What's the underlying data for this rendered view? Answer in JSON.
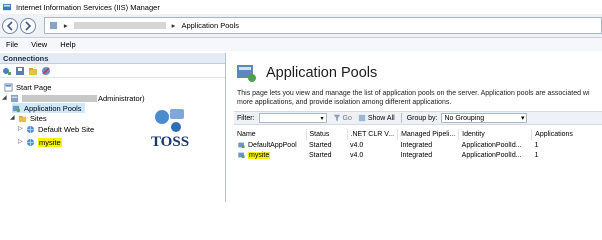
{
  "window": {
    "title": "Internet Information Services (IIS) Manager"
  },
  "address": {
    "segments": [
      "",
      "Application Pools"
    ]
  },
  "menu": {
    "items": [
      "File",
      "View",
      "Help"
    ]
  },
  "connections": {
    "header": "Connections",
    "tree": {
      "start_page": "Start Page",
      "server": "Administrator)",
      "app_pools": "Application Pools",
      "sites": "Sites",
      "default_site": "Default Web Site",
      "mysite": "mysite"
    }
  },
  "main": {
    "title": "Application Pools",
    "description_line1": "This page lets you view and manage the list of application pools on the server. Application pools are associated wi",
    "description_line2": "more applications, and provide isolation among different applications.",
    "filter": {
      "label": "Filter:",
      "go": "Go",
      "show_all": "Show All",
      "group_by_label": "Group by:",
      "group_by_value": "No Grouping"
    },
    "table": {
      "headers": [
        "Name",
        "Status",
        ".NET CLR V...",
        "Managed Pipeli...",
        "Identity",
        "Applications"
      ],
      "rows": [
        [
          "DefaultAppPool",
          "Started",
          "v4.0",
          "Integrated",
          "ApplicationPoolId...",
          "1"
        ],
        [
          "mysite",
          "Started",
          "v4.0",
          "Integrated",
          "ApplicationPoolId...",
          "1"
        ]
      ]
    }
  },
  "logo": {
    "text": "TOSS"
  },
  "colors": {
    "highlight": "#f4f200",
    "selection": "#cde8ff",
    "header_bg": "#e4ebf4"
  }
}
